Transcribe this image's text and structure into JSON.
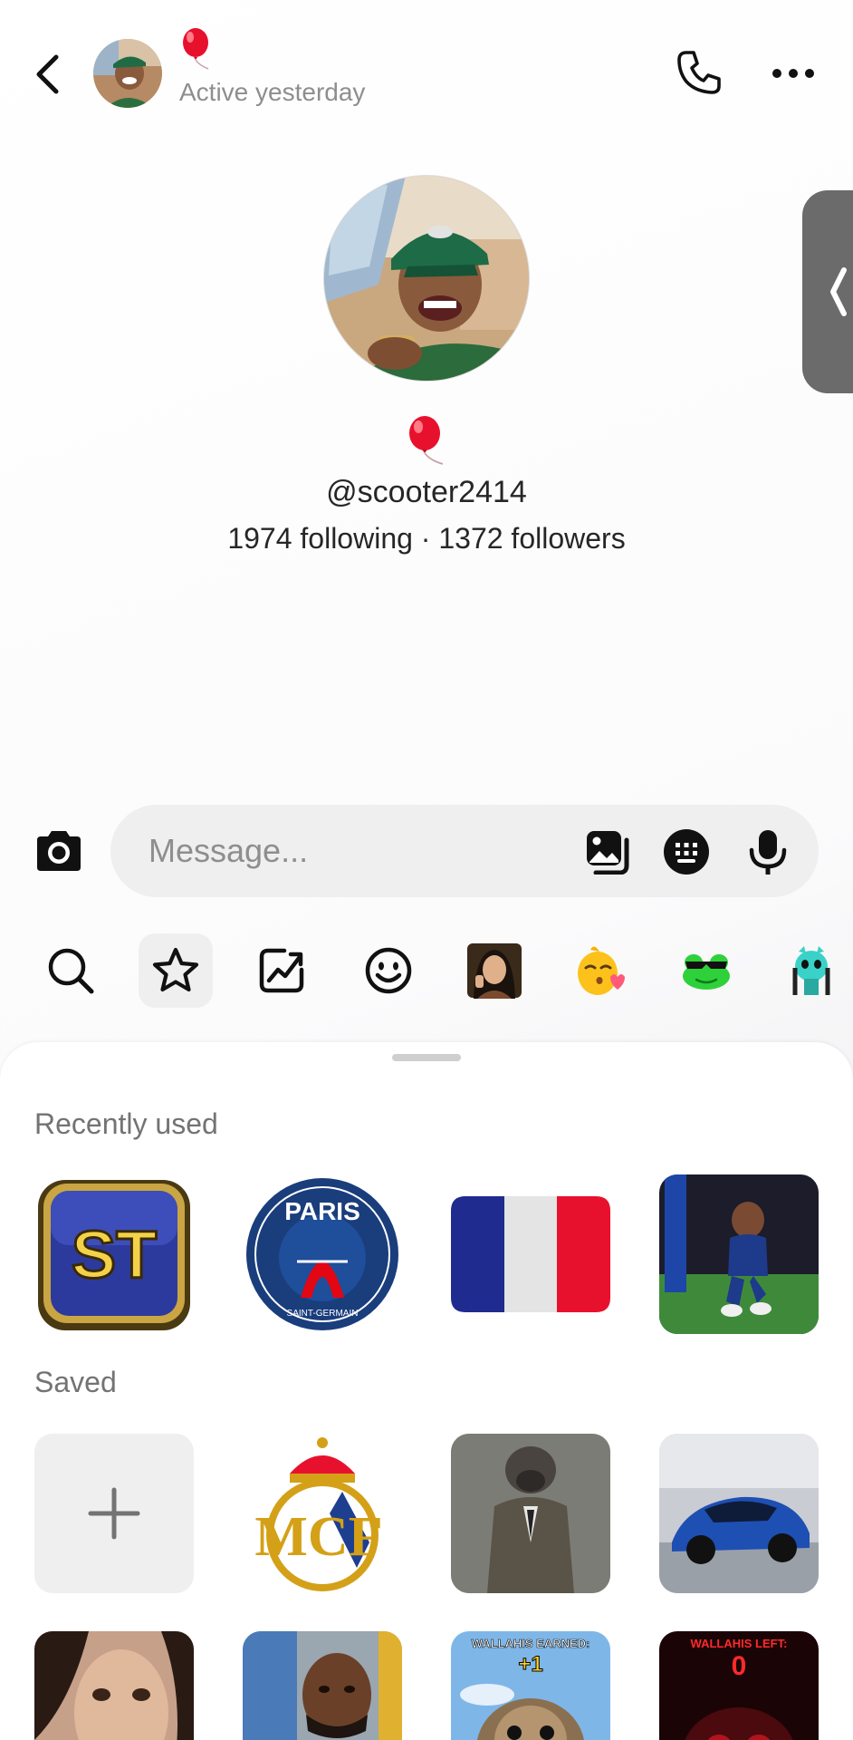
{
  "header": {
    "status": "Active yesterday",
    "icons": {
      "back": "chevron-left-icon",
      "call": "phone-icon",
      "more": "more-horizontal-icon",
      "status_emoji": "balloon-icon"
    }
  },
  "profile": {
    "username": "@scooter2414",
    "stats": "1974 following · 1372 followers"
  },
  "composer": {
    "placeholder": "Message...",
    "icons": [
      "camera-icon",
      "gallery-icon",
      "sticker-icon",
      "microphone-icon"
    ]
  },
  "sticker_tabs": [
    "search-icon",
    "star-icon",
    "trending-icon",
    "smiley-icon",
    "selfie-sticker",
    "kiss-emoji-sticker",
    "frog-sticker",
    "monster-sticker"
  ],
  "recently_used": {
    "title": "Recently used",
    "items": [
      {
        "name": "st-logo-sticker",
        "text": "ST"
      },
      {
        "name": "psg-crest-sticker",
        "text": "PARIS",
        "subtext": "SAINT-GERMAIN"
      },
      {
        "name": "france-flag-sticker"
      },
      {
        "name": "football-player-sticker"
      }
    ]
  },
  "saved": {
    "title": "Saved",
    "items": [
      {
        "name": "add-sticker-button"
      },
      {
        "name": "real-madrid-crest-sticker"
      },
      {
        "name": "suited-figure-sticker"
      },
      {
        "name": "blue-supercar-sticker"
      },
      {
        "name": "woman-face-sticker"
      },
      {
        "name": "man-selfie-sticker"
      },
      {
        "name": "dog-earned-sticker",
        "text": "WALLAHIS EARNED:",
        "value": "+1"
      },
      {
        "name": "dog-left-sticker",
        "text": "WALLAHIS LEFT:",
        "value": "0"
      }
    ]
  },
  "colors": {
    "accent_red": "#e8112d",
    "france_blue": "#1f2b8f",
    "psg_blue": "#1a3d7c",
    "side_tab": "#6b6b6b"
  }
}
